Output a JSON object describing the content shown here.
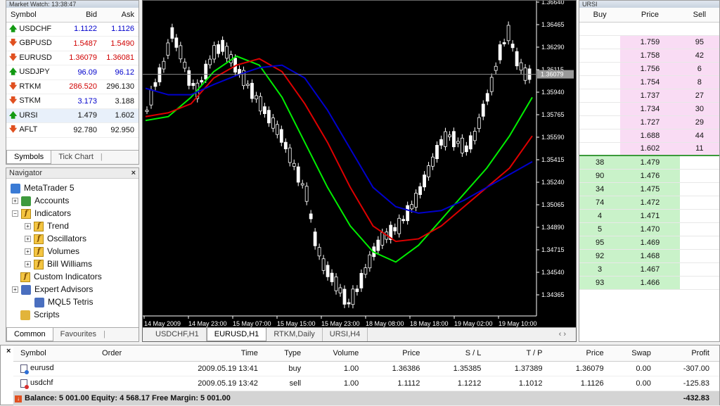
{
  "market_watch": {
    "title": "Market Watch: 13:38:47",
    "headers": [
      "Symbol",
      "Bid",
      "Ask"
    ],
    "rows": [
      {
        "symbol": "USDCHF",
        "bid": "1.1122",
        "ask": "1.1126",
        "dir": "up",
        "bid_color": "#0000cc",
        "ask_color": "#0000cc"
      },
      {
        "symbol": "GBPUSD",
        "bid": "1.5487",
        "ask": "1.5490",
        "dir": "down",
        "bid_color": "#d00000",
        "ask_color": "#d00000"
      },
      {
        "symbol": "EURUSD",
        "bid": "1.36079",
        "ask": "1.36081",
        "dir": "down",
        "bid_color": "#d00000",
        "ask_color": "#d00000"
      },
      {
        "symbol": "USDJPY",
        "bid": "96.09",
        "ask": "96.12",
        "dir": "up",
        "bid_color": "#0000cc",
        "ask_color": "#0000cc"
      },
      {
        "symbol": "RTKM",
        "bid": "286.520",
        "ask": "296.130",
        "dir": "down",
        "bid_color": "#d00000",
        "ask_color": "#111111"
      },
      {
        "symbol": "STKM",
        "bid": "3.173",
        "ask": "3.188",
        "dir": "down",
        "bid_color": "#0000cc",
        "ask_color": "#111111"
      },
      {
        "symbol": "URSI",
        "bid": "1.479",
        "ask": "1.602",
        "dir": "up",
        "bid_color": "#111111",
        "ask_color": "#111111"
      },
      {
        "symbol": "AFLT",
        "bid": "92.780",
        "ask": "92.950",
        "dir": "down",
        "bid_color": "#111111",
        "ask_color": "#111111"
      }
    ],
    "tabs": [
      "Symbols",
      "Tick Chart"
    ]
  },
  "navigator": {
    "title": "Navigator",
    "close": "×",
    "items": [
      {
        "label": "MetaTrader 5",
        "icon": "mt5-icon"
      },
      {
        "label": "Accounts",
        "icon": "accounts-icon"
      },
      {
        "label": "Indicators",
        "icon": "indicator-icon"
      },
      {
        "label": "Trend",
        "icon": "indicator-icon"
      },
      {
        "label": "Oscillators",
        "icon": "indicator-icon"
      },
      {
        "label": "Volumes",
        "icon": "indicator-icon"
      },
      {
        "label": "Bill Williams",
        "icon": "indicator-icon"
      },
      {
        "label": "Custom Indicators",
        "icon": "indicator-icon"
      },
      {
        "label": "Expert Advisors",
        "icon": "expert-icon"
      },
      {
        "label": "MQL5 Tetris",
        "icon": "expert-icon"
      },
      {
        "label": "Scripts",
        "icon": "script-icon"
      }
    ],
    "tabs": [
      "Common",
      "Favourites"
    ]
  },
  "chart": {
    "price_labels": [
      "1.36640",
      "1.36465",
      "1.36290",
      "1.36115",
      "1.35940",
      "1.35765",
      "1.35590",
      "1.35415",
      "1.35240",
      "1.35065",
      "1.34890",
      "1.34715",
      "1.34540",
      "1.34365"
    ],
    "current_price": "1.36079",
    "time_labels": [
      "14 May 2009",
      "14 May 23:00",
      "15 May 07:00",
      "15 May 15:00",
      "15 May 23:00",
      "18 May 08:00",
      "18 May 18:00",
      "19 May 02:00",
      "19 May 10:00"
    ],
    "tabs": [
      "USDCHF,H1",
      "EURUSD,H1",
      "RTKM,Daily",
      "URSI,H4"
    ],
    "active_tab": 1,
    "nav_arrows": "‹ ›",
    "colors": {
      "candle": "#ffffff",
      "up_line": "#00ee00",
      "red_ma": "#dd0000",
      "blue_ma": "#0000cc",
      "bg": "#000000"
    }
  },
  "depth": {
    "title": "URSI",
    "headers": [
      "Buy",
      "Price",
      "Sell"
    ],
    "sell_rows": [
      {
        "price": "1.759",
        "vol": "95"
      },
      {
        "price": "1.758",
        "vol": "42"
      },
      {
        "price": "1.756",
        "vol": "6"
      },
      {
        "price": "1.754",
        "vol": "8"
      },
      {
        "price": "1.737",
        "vol": "27"
      },
      {
        "price": "1.734",
        "vol": "30"
      },
      {
        "price": "1.727",
        "vol": "29"
      },
      {
        "price": "1.688",
        "vol": "44"
      },
      {
        "price": "1.602",
        "vol": "11"
      }
    ],
    "buy_rows": [
      {
        "vol": "38",
        "price": "1.479"
      },
      {
        "vol": "90",
        "price": "1.476"
      },
      {
        "vol": "34",
        "price": "1.475"
      },
      {
        "vol": "74",
        "price": "1.472"
      },
      {
        "vol": "4",
        "price": "1.471"
      },
      {
        "vol": "5",
        "price": "1.470"
      },
      {
        "vol": "95",
        "price": "1.469"
      },
      {
        "vol": "92",
        "price": "1.468"
      },
      {
        "vol": "3",
        "price": "1.467"
      },
      {
        "vol": "93",
        "price": "1.466"
      }
    ]
  },
  "terminal": {
    "close": "×",
    "headers": [
      "Symbol",
      "Order",
      "Time",
      "Type",
      "Volume",
      "Price",
      "S / L",
      "T / P",
      "Price",
      "Swap",
      "Profit"
    ],
    "rows": [
      {
        "symbol": "eurusd",
        "order": "",
        "time": "2009.05.19 13:41",
        "type": "buy",
        "volume": "1.00",
        "price": "1.36386",
        "sl": "1.35385",
        "tp": "1.37389",
        "cur": "1.36079",
        "swap": "0.00",
        "profit": "-307.00"
      },
      {
        "symbol": "usdchf",
        "order": "",
        "time": "2009.05.19 13:42",
        "type": "sell",
        "volume": "1.00",
        "price": "1.1112",
        "sl": "1.1212",
        "tp": "1.1012",
        "cur": "1.1126",
        "swap": "0.00",
        "profit": "-125.83"
      }
    ],
    "balance_text": "Balance: 5 001.00  Equity: 4 568.17  Free Margin: 5 001.00",
    "total_profit": "-432.83"
  }
}
